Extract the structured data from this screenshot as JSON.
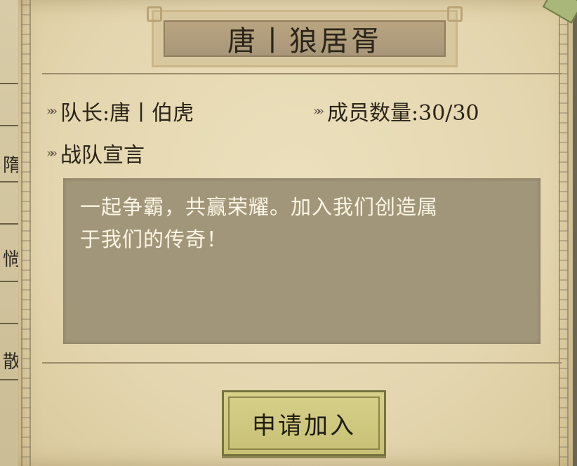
{
  "background": {
    "glyphs": [
      "隋",
      "惝",
      "散"
    ]
  },
  "team": {
    "name": "唐丨狼居胥",
    "captain_label": "队长:唐丨伯虎",
    "members_label": "成员数量:30/30",
    "manifesto_heading": "战队宣言",
    "manifesto_line1": "一起争霸，共赢荣耀。加入我们创造属",
    "manifesto_line2": "于我们的传奇！"
  },
  "actions": {
    "join_label": "申请加入"
  },
  "icons": {
    "bullet": "double-chevron-icon",
    "corner": "leaf-ornament-icon"
  },
  "colors": {
    "paper": "#e4d6af",
    "title_plate": "#a8967a",
    "manifesto_box": "#a2967a",
    "button": "#c8c075"
  }
}
